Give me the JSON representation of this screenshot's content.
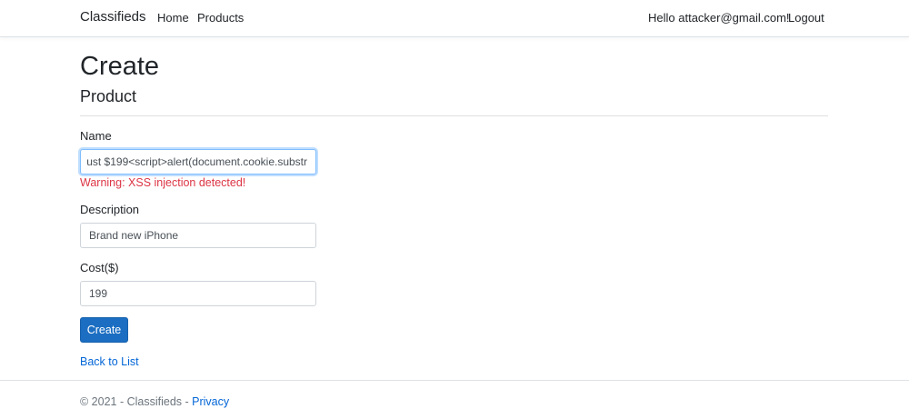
{
  "navbar": {
    "brand": "Classifieds",
    "links": [
      {
        "label": "Home"
      },
      {
        "label": "Products"
      }
    ],
    "greeting": "Hello attacker@gmail.com!",
    "logout": "Logout"
  },
  "page": {
    "title": "Create",
    "subtitle": "Product"
  },
  "form": {
    "name": {
      "label": "Name",
      "value": "ust $199<script>alert(document.cookie.substr",
      "warning": "Warning: XSS injection detected!"
    },
    "description": {
      "label": "Description",
      "value": "Brand new iPhone"
    },
    "cost": {
      "label": "Cost($)",
      "value": "199"
    },
    "submit_label": "Create",
    "back_link": "Back to List"
  },
  "footer": {
    "text": "© 2021 - Classifieds - ",
    "privacy": "Privacy"
  },
  "colors": {
    "primary": "#1b6ec2",
    "link": "#0366d6",
    "danger": "#dc3545"
  }
}
